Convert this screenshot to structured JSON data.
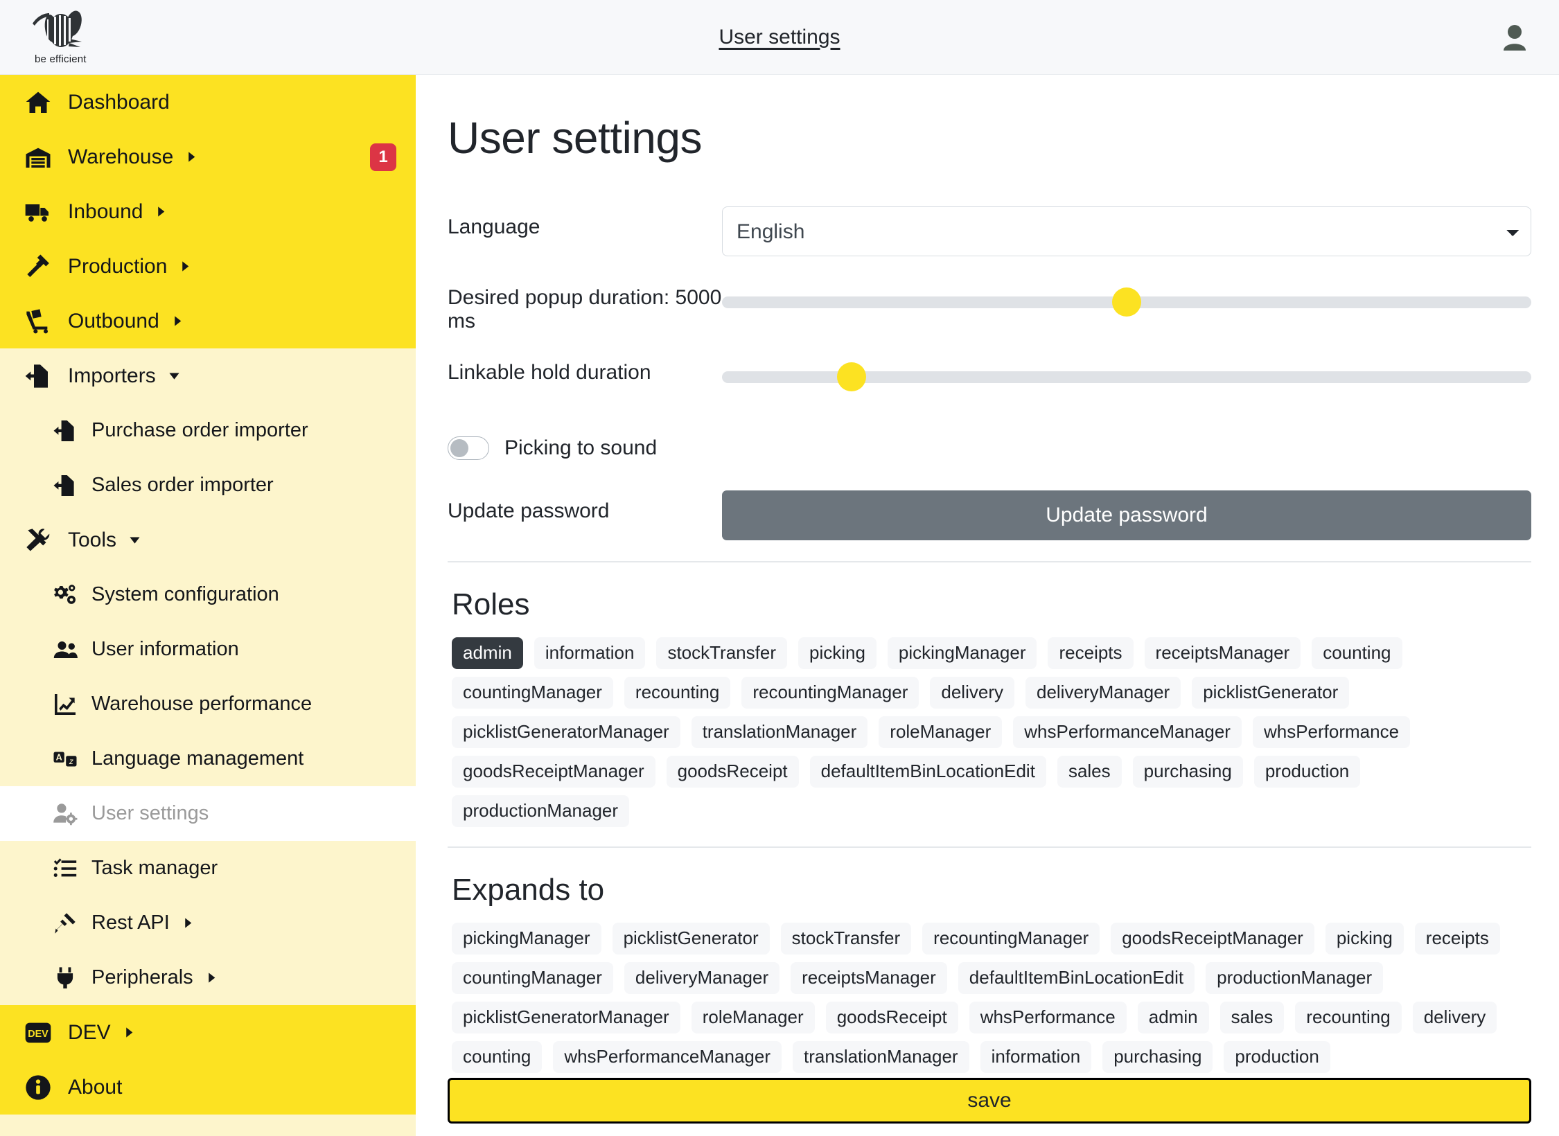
{
  "topbar": {
    "logo_caption": "be efficient",
    "title": "User settings",
    "user_icon": "user-avatar-icon"
  },
  "sidebar": {
    "items": [
      {
        "label": "Dashboard",
        "icon": "home-icon",
        "level": 0,
        "state": "closed",
        "caret": "",
        "badge": ""
      },
      {
        "label": "Warehouse",
        "icon": "warehouse-icon",
        "level": 0,
        "state": "closed",
        "caret": "right",
        "badge": "1"
      },
      {
        "label": "Inbound",
        "icon": "truck-icon",
        "level": 0,
        "state": "closed",
        "caret": "right",
        "badge": ""
      },
      {
        "label": "Production",
        "icon": "hammer-icon",
        "level": 0,
        "state": "closed",
        "caret": "right",
        "badge": ""
      },
      {
        "label": "Outbound",
        "icon": "dolly-icon",
        "level": 0,
        "state": "closed",
        "caret": "right",
        "badge": ""
      },
      {
        "label": "Importers",
        "icon": "file-import-icon",
        "level": 0,
        "state": "open",
        "caret": "down",
        "badge": ""
      },
      {
        "label": "Purchase order importer",
        "icon": "file-import-icon",
        "level": 1,
        "state": "closed",
        "caret": "",
        "badge": ""
      },
      {
        "label": "Sales order importer",
        "icon": "file-import-icon",
        "level": 1,
        "state": "closed",
        "caret": "",
        "badge": ""
      },
      {
        "label": "Tools",
        "icon": "tools-icon",
        "level": 0,
        "state": "open",
        "caret": "down",
        "badge": ""
      },
      {
        "label": "System configuration",
        "icon": "cogs-icon",
        "level": 1,
        "state": "closed",
        "caret": "",
        "badge": ""
      },
      {
        "label": "User information",
        "icon": "users-icon",
        "level": 1,
        "state": "closed",
        "caret": "",
        "badge": ""
      },
      {
        "label": "Warehouse performance",
        "icon": "chart-line-icon",
        "level": 1,
        "state": "closed",
        "caret": "",
        "badge": ""
      },
      {
        "label": "Language management",
        "icon": "language-icon",
        "level": 1,
        "state": "closed",
        "caret": "",
        "badge": ""
      },
      {
        "label": "User settings",
        "icon": "user-cog-icon",
        "level": 1,
        "state": "active",
        "caret": "",
        "badge": ""
      },
      {
        "label": "Task manager",
        "icon": "tasks-icon",
        "level": 1,
        "state": "closed",
        "caret": "",
        "badge": ""
      },
      {
        "label": "Rest API",
        "icon": "plug-connect-icon",
        "level": 1,
        "state": "closed",
        "caret": "right",
        "badge": ""
      },
      {
        "label": "Peripherals",
        "icon": "plug-icon",
        "level": 1,
        "state": "closed",
        "caret": "right",
        "badge": ""
      },
      {
        "label": "DEV",
        "icon": "dev-badge-icon",
        "level": 0,
        "state": "closed",
        "caret": "right",
        "badge": ""
      },
      {
        "label": "About",
        "icon": "info-circle-icon",
        "level": 0,
        "state": "closed",
        "caret": "",
        "badge": ""
      }
    ]
  },
  "main": {
    "page_title": "User settings",
    "form": {
      "language_label": "Language",
      "language_value": "English",
      "language_options": [
        "English"
      ],
      "popup_duration_label": "Desired popup duration: 5000 ms",
      "popup_duration_percent": 50,
      "linkable_hold_label": "Linkable hold duration",
      "linkable_hold_percent": 16,
      "picking_sound_label": "Picking to sound",
      "picking_sound_on": false,
      "update_password_label": "Update password",
      "update_password_button": "Update password"
    },
    "roles": {
      "title": "Roles",
      "selected": [
        "admin"
      ],
      "tags": [
        "admin",
        "information",
        "stockTransfer",
        "picking",
        "pickingManager",
        "receipts",
        "receiptsManager",
        "counting",
        "countingManager",
        "recounting",
        "recountingManager",
        "delivery",
        "deliveryManager",
        "picklistGenerator",
        "picklistGeneratorManager",
        "translationManager",
        "roleManager",
        "whsPerformanceManager",
        "whsPerformance",
        "goodsReceiptManager",
        "goodsReceipt",
        "defaultItemBinLocationEdit",
        "sales",
        "purchasing",
        "production",
        "productionManager"
      ]
    },
    "expands_to": {
      "title": "Expands to",
      "tags": [
        "pickingManager",
        "picklistGenerator",
        "stockTransfer",
        "recountingManager",
        "goodsReceiptManager",
        "picking",
        "receipts",
        "countingManager",
        "deliveryManager",
        "receiptsManager",
        "defaultItemBinLocationEdit",
        "productionManager",
        "picklistGeneratorManager",
        "roleManager",
        "goodsReceipt",
        "whsPerformance",
        "admin",
        "sales",
        "recounting",
        "delivery",
        "counting",
        "whsPerformanceManager",
        "translationManager",
        "information",
        "purchasing",
        "production"
      ]
    },
    "save_button": "save"
  },
  "colors": {
    "brand_yellow": "#FCE222",
    "sidebar_open_yellow": "#FDF5CC",
    "badge_red": "#DC3545",
    "button_gray": "#6C757D",
    "tag_bg": "#F6F7F9",
    "tag_selected_bg": "#343A40"
  }
}
